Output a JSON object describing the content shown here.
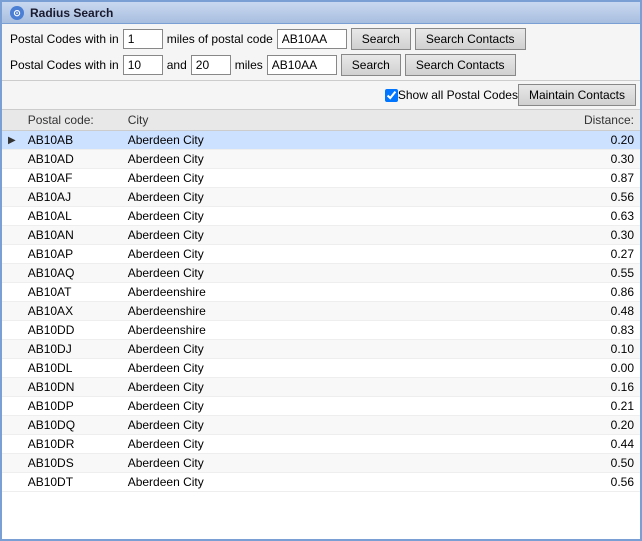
{
  "window": {
    "title": "Radius Search",
    "icon": "●"
  },
  "row1": {
    "label1": "Postal Codes with in",
    "input1_value": "1",
    "label2": "miles of postal code",
    "input2_value": "AB10AA",
    "btn_search": "Search",
    "btn_search_contacts": "Search Contacts"
  },
  "row2": {
    "label1": "Postal Codes with in",
    "input1_value": "10",
    "label_and": "and",
    "input2_value": "20",
    "label2": "miles",
    "input3_value": "AB10AA",
    "btn_search": "Search",
    "btn_search_contacts": "Search Contacts"
  },
  "row3": {
    "checkbox_label": "Show all Postal Codes",
    "btn_maintain": "Maintain Contacts"
  },
  "table": {
    "headers": {
      "postal_code": "Postal code:",
      "city": "City",
      "distance": "Distance:"
    },
    "rows": [
      {
        "postal_code": "AB10AB",
        "city": "Aberdeen City",
        "distance": "0.20",
        "selected": true
      },
      {
        "postal_code": "AB10AD",
        "city": "Aberdeen City",
        "distance": "0.30",
        "selected": false
      },
      {
        "postal_code": "AB10AF",
        "city": "Aberdeen City",
        "distance": "0.87",
        "selected": false
      },
      {
        "postal_code": "AB10AJ",
        "city": "Aberdeen City",
        "distance": "0.56",
        "selected": false
      },
      {
        "postal_code": "AB10AL",
        "city": "Aberdeen City",
        "distance": "0.63",
        "selected": false
      },
      {
        "postal_code": "AB10AN",
        "city": "Aberdeen City",
        "distance": "0.30",
        "selected": false
      },
      {
        "postal_code": "AB10AP",
        "city": "Aberdeen City",
        "distance": "0.27",
        "selected": false
      },
      {
        "postal_code": "AB10AQ",
        "city": "Aberdeen City",
        "distance": "0.55",
        "selected": false
      },
      {
        "postal_code": "AB10AT",
        "city": "Aberdeenshire",
        "distance": "0.86",
        "selected": false
      },
      {
        "postal_code": "AB10AX",
        "city": "Aberdeenshire",
        "distance": "0.48",
        "selected": false
      },
      {
        "postal_code": "AB10DD",
        "city": "Aberdeenshire",
        "distance": "0.83",
        "selected": false
      },
      {
        "postal_code": "AB10DJ",
        "city": "Aberdeen City",
        "distance": "0.10",
        "selected": false
      },
      {
        "postal_code": "AB10DL",
        "city": "Aberdeen City",
        "distance": "0.00",
        "selected": false
      },
      {
        "postal_code": "AB10DN",
        "city": "Aberdeen City",
        "distance": "0.16",
        "selected": false
      },
      {
        "postal_code": "AB10DP",
        "city": "Aberdeen City",
        "distance": "0.21",
        "selected": false
      },
      {
        "postal_code": "AB10DQ",
        "city": "Aberdeen City",
        "distance": "0.20",
        "selected": false
      },
      {
        "postal_code": "AB10DR",
        "city": "Aberdeen City",
        "distance": "0.44",
        "selected": false
      },
      {
        "postal_code": "AB10DS",
        "city": "Aberdeen City",
        "distance": "0.50",
        "selected": false
      },
      {
        "postal_code": "AB10DT",
        "city": "Aberdeen City",
        "distance": "0.56",
        "selected": false
      }
    ]
  }
}
